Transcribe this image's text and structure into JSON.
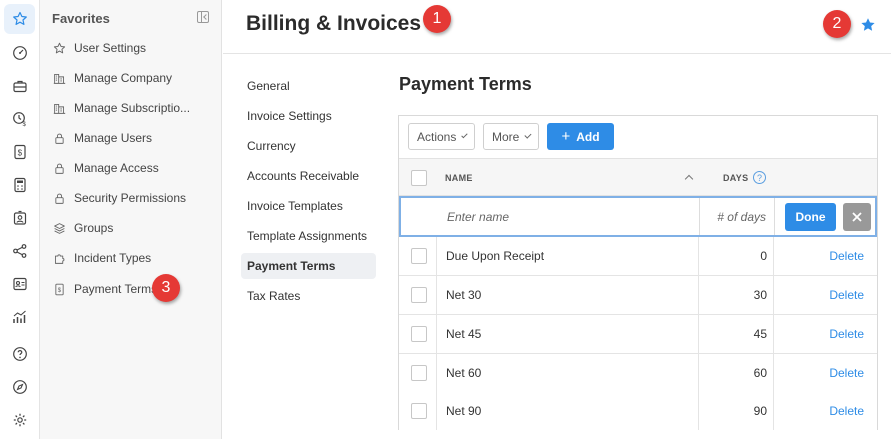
{
  "favorites": {
    "title": "Favorites",
    "items": [
      {
        "label": "User Settings",
        "icon": "star-outline-icon"
      },
      {
        "label": "Manage Company",
        "icon": "building-icon"
      },
      {
        "label": "Manage Subscriptio...",
        "icon": "building-icon"
      },
      {
        "label": "Manage Users",
        "icon": "lock-icon"
      },
      {
        "label": "Manage Access",
        "icon": "lock-icon"
      },
      {
        "label": "Security Permissions",
        "icon": "lock-icon"
      },
      {
        "label": "Groups",
        "icon": "layers-icon"
      },
      {
        "label": "Incident Types",
        "icon": "puzzle-icon"
      },
      {
        "label": "Payment Terms",
        "icon": "invoice-icon"
      }
    ]
  },
  "header": {
    "title": "Billing & Invoices",
    "favorite_icon": "star-filled-icon"
  },
  "annotations": [
    "1",
    "2",
    "3"
  ],
  "subnav": {
    "items": [
      {
        "label": "General"
      },
      {
        "label": "Invoice Settings"
      },
      {
        "label": "Currency"
      },
      {
        "label": "Accounts Receivable"
      },
      {
        "label": "Invoice Templates"
      },
      {
        "label": "Template Assignments"
      },
      {
        "label": "Payment Terms",
        "active": true
      },
      {
        "label": "Tax Rates"
      }
    ]
  },
  "section": {
    "title": "Payment Terms"
  },
  "toolbar": {
    "actions_label": "Actions",
    "more_label": "More",
    "add_label": "Add"
  },
  "table": {
    "columns": {
      "name": "NAME",
      "days": "DAYS"
    },
    "help_glyph": "?",
    "edit_row": {
      "name_placeholder": "Enter name",
      "days_placeholder": "# of days",
      "done_label": "Done"
    },
    "rows": [
      {
        "name": "Due Upon Receipt",
        "days": "0",
        "action": "Delete"
      },
      {
        "name": "Net 30",
        "days": "30",
        "action": "Delete"
      },
      {
        "name": "Net 45",
        "days": "45",
        "action": "Delete"
      },
      {
        "name": "Net 60",
        "days": "60",
        "action": "Delete"
      },
      {
        "name": "Net 90",
        "days": "90",
        "action": "Delete"
      }
    ]
  },
  "colors": {
    "accent": "#2e8ce6",
    "badge": "#e53935"
  }
}
